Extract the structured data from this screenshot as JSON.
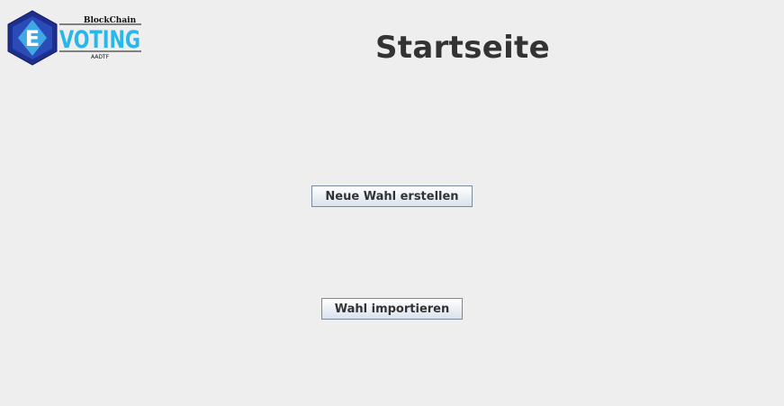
{
  "logo": {
    "letter": "E",
    "top_text": "BlockChain",
    "word": "VOTING",
    "bottom_text": "AADTF"
  },
  "page": {
    "title": "Startseite"
  },
  "buttons": {
    "new_election": "Neue Wahl erstellen",
    "import_election": "Wahl importieren"
  },
  "colors": {
    "background": "#eeeeee",
    "title_text": "#333333",
    "logo_blue_dark": "#1a2f8a",
    "logo_blue_light": "#29b6e8"
  }
}
